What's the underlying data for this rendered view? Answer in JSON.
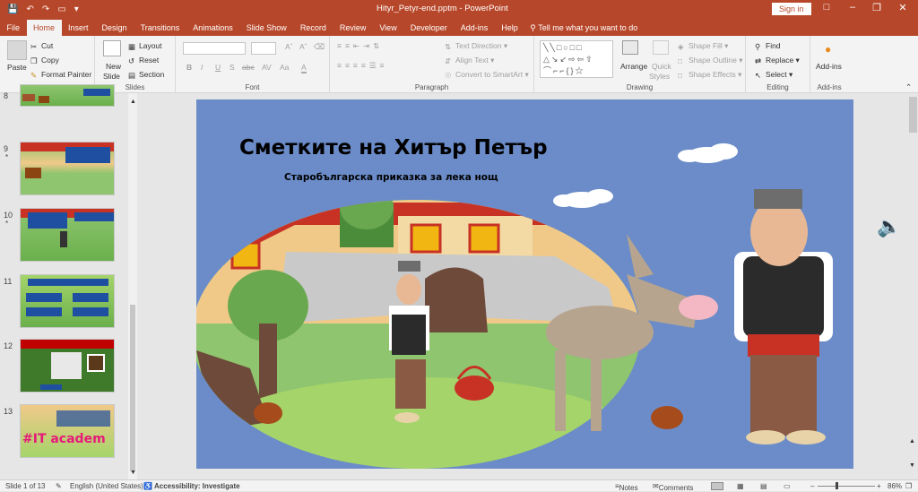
{
  "window": {
    "doc_title": "Hityr_Petyr-end.pptm",
    "app_name": "PowerPoint",
    "title_sep": " - ",
    "sign_in": "Sign in"
  },
  "tabs": [
    "File",
    "Home",
    "Insert",
    "Design",
    "Transitions",
    "Animations",
    "Slide Show",
    "Record",
    "Review",
    "View",
    "Developer",
    "Add-ins",
    "Help"
  ],
  "active_tab": "Home",
  "tell_me": "Tell me what you want to do",
  "ribbon": {
    "clipboard": {
      "paste": "Paste",
      "cut": "Cut",
      "copy": "Copy",
      "format_painter": "Format Painter",
      "label": "Clipboard"
    },
    "slides": {
      "new_slide": "New",
      "new_slide2": "Slide",
      "layout": "Layout",
      "reset": "Reset",
      "section": "Section",
      "label": "Slides"
    },
    "font": {
      "label": "Font",
      "bold": "B",
      "italic": "I",
      "underline": "U",
      "strike": "S",
      "abc": "abc",
      "spacing": "AV",
      "case": "Aa",
      "color": "A"
    },
    "paragraph": {
      "text_direction": "Text Direction",
      "align_text": "Align Text",
      "smartart": "Convert to SmartArt",
      "label": "Paragraph"
    },
    "drawing": {
      "arrange": "Arrange",
      "quick_styles": "Quick",
      "quick_styles2": "Styles",
      "shape_fill": "Shape Fill",
      "shape_outline": "Shape Outline",
      "shape_effects": "Shape Effects",
      "label": "Drawing"
    },
    "editing": {
      "find": "Find",
      "replace": "Replace",
      "select": "Select",
      "label": "Editing"
    },
    "addins": {
      "addins": "Add-ins",
      "label": "Add-ins"
    }
  },
  "thumbnails": [
    {
      "num": "9",
      "star": "*"
    },
    {
      "num": "10",
      "star": "*"
    },
    {
      "num": "11",
      "star": ""
    },
    {
      "num": "12",
      "star": ""
    },
    {
      "num": "13",
      "star": ""
    }
  ],
  "thumb_text": {
    "t13": "#IT academ"
  },
  "slide": {
    "title": "Сметките на Хитър Петър",
    "subtitle": "Старобългарска приказка за лека нощ"
  },
  "status": {
    "slide_of": "Slide 1 of 13",
    "language": "English (United States)",
    "accessibility": "Accessibility: Investigate",
    "notes": "Notes",
    "comments": "Comments",
    "zoom": "86%"
  },
  "colors": {
    "accent": "#b7472a",
    "slide_bg": "#6b8cc8"
  }
}
